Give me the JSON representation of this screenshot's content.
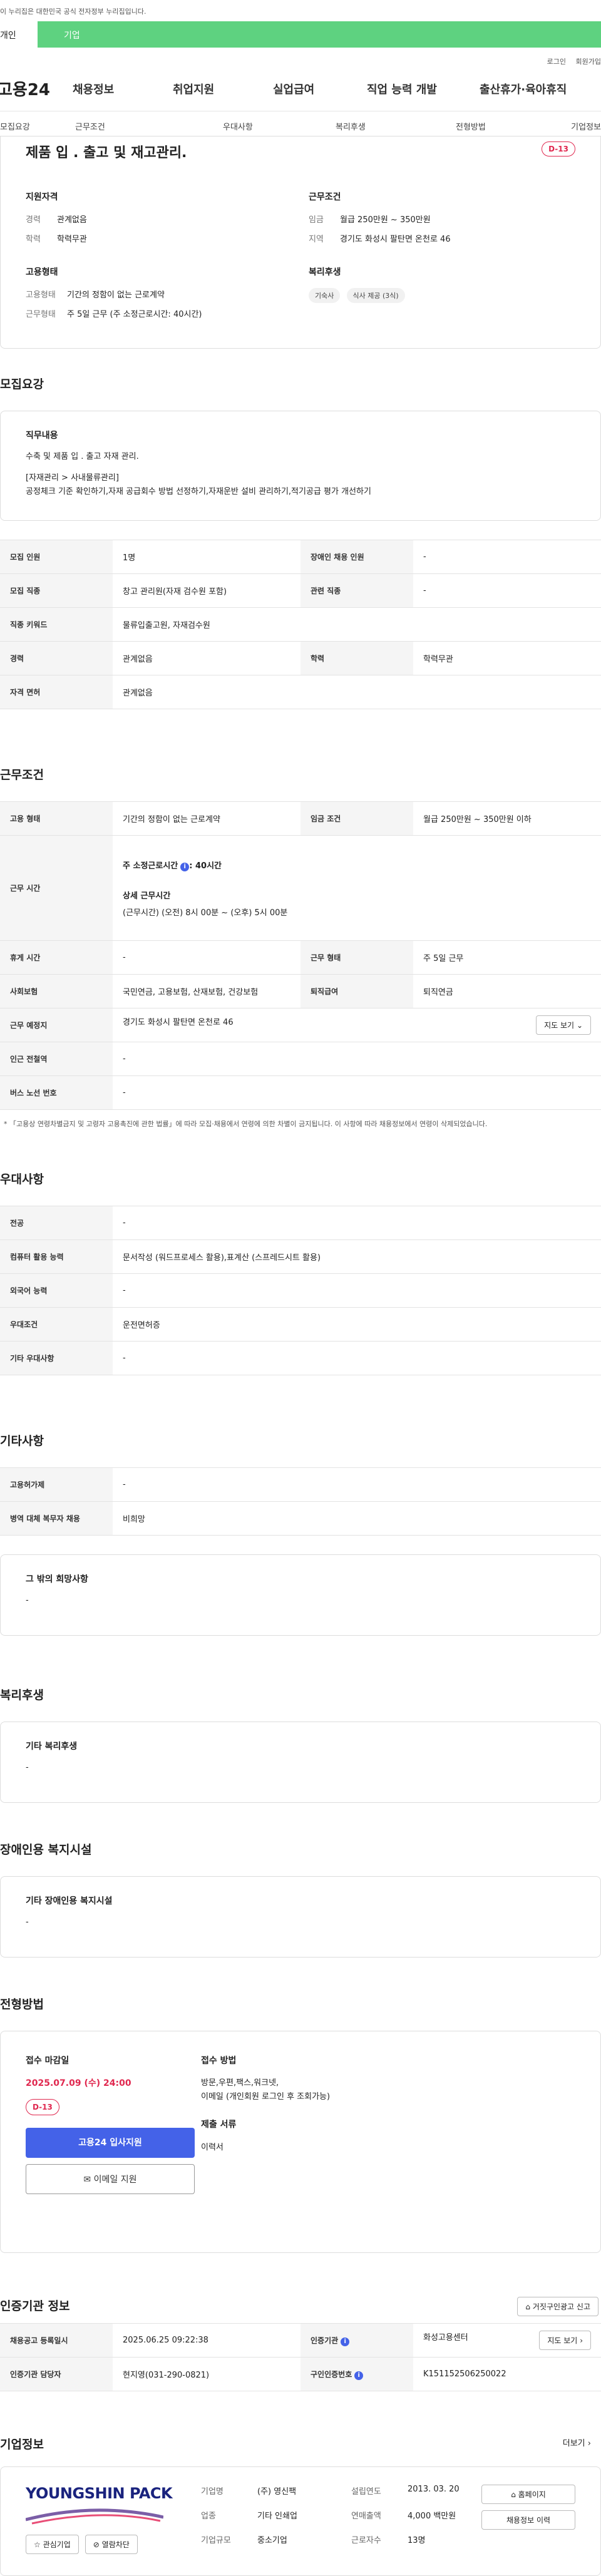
{
  "gov_bar": "이 누리집은 대한민국 공식 전자정부 누리집입니다.",
  "user_tabs": [
    "개인",
    "기업"
  ],
  "util": [
    "로그인",
    "회원가입"
  ],
  "gnb": {
    "logo": "고용24",
    "menu": [
      "채용정보",
      "취업지원",
      "실업급여",
      "직업 능력 개발",
      "출산휴가·육아휴직"
    ]
  },
  "tabs": [
    "모집요강",
    "근무조건",
    "우대사항",
    "복리후생",
    "전형방법",
    "기업정보"
  ],
  "summary": {
    "title": "제품 입 . 출고 및 재고관리.",
    "dday": "D-13",
    "qual_title": "지원자격",
    "qual": [
      {
        "k": "경력",
        "v": "관계없음"
      },
      {
        "k": "학력",
        "v": "학력무관"
      }
    ],
    "emp_title": "고용형태",
    "emp": [
      {
        "k": "고용형태",
        "v": "기간의 정함이 없는 근로계약"
      },
      {
        "k": "근무형태",
        "v": "주 5일 근무 (주 소정근로시간: 40시간)"
      }
    ],
    "cond_title": "근무조건",
    "cond": [
      {
        "k": "임금",
        "v": "월급 250만원 ~ 350만원"
      },
      {
        "k": "지역",
        "v": "경기도 화성시 팔탄면 온천로 46"
      }
    ],
    "welfare_title": "복리후생",
    "welfare": [
      "기숙사",
      "식사 제공 (3식)"
    ]
  },
  "recruit": {
    "title": "모집요강",
    "duty_title": "직무내용",
    "duty_lines": [
      "수축 및 제품 입 . 출고  자재 관리.",
      "",
      "[자재관리 > 사내물류관리]",
      "공정체크 기준 확인하기,자재 공급회수 방법 선정하기,자재운반 설비 관리하기,적기공급 평가 개선하기"
    ],
    "rows": [
      [
        "모집 인원",
        "1명",
        "장애인 채용 인원",
        "-"
      ],
      [
        "모집 직종",
        "창고 관리원(자재 검수원 포함)",
        "관련 직종",
        "-"
      ],
      [
        "직종 키워드",
        "물류입출고원, 자재검수원"
      ],
      [
        "경력",
        "관계없음",
        "학력",
        "학력무관"
      ],
      [
        "자격 면허",
        "관계없음"
      ]
    ]
  },
  "work": {
    "title": "근무조건",
    "emp_type_k": "고용 형태",
    "emp_type_v": "기간의 정함이 없는 근로계약",
    "wage_k": "임금 조건",
    "wage_v": "월급 250만원 ~ 350만원 이하",
    "hours_k": "근무 시간",
    "hours_main": "주 소정근로시간",
    "hours_main_v": ": 40시간",
    "hours_detail_t": "상세 근무시간",
    "hours_detail_v": "(근무시간) (오전) 8시 00분 ~ (오후) 5시 00분",
    "rows": [
      [
        "휴게 시간",
        "-",
        "근무 형태",
        "주 5일 근무"
      ],
      [
        "사회보험",
        "국민연금, 고용보험, 산재보험, 건강보험",
        "퇴직급여",
        "퇴직연금"
      ]
    ],
    "loc_k": "근무 예정지",
    "loc_v": "경기도 화성시 팔탄면 온천로 46",
    "map_btn": "지도 보기",
    "subway_k": "인근 전철역",
    "subway_v": "-",
    "bus_k": "버스 노선 번호",
    "bus_v": "-",
    "note": "* 「고용상 연령차별금지 및 고령자 고용촉진에 관한 법률」에 따라 모집·채용에서 연령에 의한 차별이 금지됩니다. 이 사항에 따라 채용정보에서 연령이 삭제되었습니다."
  },
  "pref": {
    "title": "우대사항",
    "rows": [
      [
        "전공",
        "-"
      ],
      [
        "컴퓨터 활용 능력",
        "문서작성 (워드프로세스 활용),표계산 (스프레드시트 활용)"
      ],
      [
        "외국어 능력",
        "-"
      ],
      [
        "우대조건",
        "운전면허증"
      ],
      [
        "기타 우대사항",
        "-"
      ]
    ]
  },
  "etc": {
    "title": "기타사항",
    "rows": [
      [
        "고용허가제",
        "-"
      ],
      [
        "병역 대체 복무자 채용",
        "비희망"
      ]
    ],
    "other_title": "그 밖의 희망사항",
    "other_v": "-"
  },
  "welfare": {
    "title": "복리후생",
    "box_title": "기타 복리후생",
    "box_v": "-"
  },
  "disab": {
    "title": "장애인용 복지시설",
    "box_title": "기타 장애인용 복지시설",
    "box_v": "-"
  },
  "apply": {
    "title": "전형방법",
    "deadline_t": "접수 마감일",
    "deadline_v": "2025.07.09 (수) 24:00",
    "dday": "D-13",
    "apply_btn": "고용24 입사지원",
    "email_btn": "이메일 지원",
    "method_t": "접수 방법",
    "method_v1": "방문,우편,팩스,워크넷,",
    "method_v2": "이메일 (개인회원 로그인 후 조회가능)",
    "docs_t": "제출 서류",
    "docs_v": "이력서"
  },
  "auth": {
    "title": "인증기관 정보",
    "report_btn": "거짓구인광고 신고",
    "reg_k": "채용공고 등록일시",
    "reg_v": "2025.06.25 09:22:38",
    "org_k": "인증기관",
    "org_v": "화성고용센터",
    "map_btn": "지도 보기",
    "mgr_k": "인증기관 담당자",
    "mgr_v": "현지영(031-290-0821)",
    "num_k": "구인인증번호",
    "num_v": "K151152506250022"
  },
  "company": {
    "title": "기업정보",
    "more": "더보기",
    "logo_text": "YOUNGSHIN PACK",
    "fav": "관심기업",
    "block": "열람차단",
    "info": [
      [
        {
          "k": "기업명",
          "v": "(주) 영신팩"
        },
        {
          "k": "설립연도",
          "v": "2013. 03. 20"
        }
      ],
      [
        {
          "k": "업종",
          "v": "기타 인쇄업"
        },
        {
          "k": "연매출액",
          "v": "4,000 백만원"
        }
      ],
      [
        {
          "k": "기업규모",
          "v": "중소기업"
        },
        {
          "k": "근로자수",
          "v": "13명"
        }
      ]
    ],
    "home_btn": "홈페이지",
    "history_btn": "채용정보 이력"
  }
}
